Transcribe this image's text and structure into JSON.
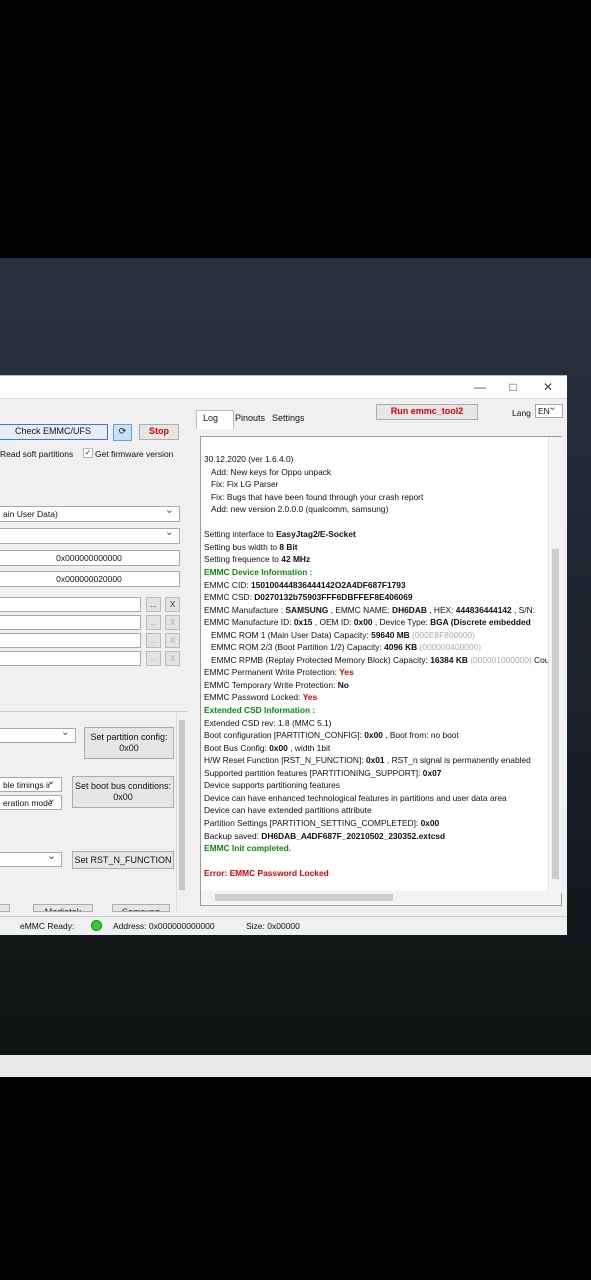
{
  "window": {
    "minimize": "—",
    "maximize": "□",
    "close": "✕"
  },
  "left": {
    "check_btn": "Check EMMC/UFS",
    "stop_btn": "Stop",
    "read_soft_partitions": "Read soft partitions",
    "get_firmware_version": "Get firmware version",
    "partition_select": "ain User Data)",
    "addr1": "0x000000000000",
    "addr2": "0x000000020000",
    "browse": "...",
    "clear": "X",
    "set_partition_config": "Set partition config:",
    "partition_config_value": "0x00",
    "timings_select": "ble timings ir",
    "operation_mode_select": "eration mode",
    "set_boot_bus": "Set boot bus conditions:",
    "boot_bus_value": "0x00",
    "set_rst": "Set RST_N_FUNCTION",
    "bottom_btn1": "Mediatek",
    "bottom_btn2": "Samsung"
  },
  "right": {
    "tabs": [
      "Log",
      "Pinouts",
      "Settings"
    ],
    "run_btn": "Run emmc_tool2",
    "lang_label": "Lang",
    "lang_value": "EN"
  },
  "log": [
    {
      "t": "30.12.2020 (ver 1.6.4.0)"
    },
    {
      "t": "  Add:   New keys for Oppo unpack",
      "i": true
    },
    {
      "t": "  Fix:    Fix LG Parser",
      "i": true
    },
    {
      "t": "  Fix:    Bugs that have been found through your crash report",
      "i": true
    },
    {
      "t": "  Add:   new version 2.0.0.0 (qualcomm, samsung)",
      "i": true
    },
    {
      "t": ""
    },
    {
      "t": "Setting interface to ",
      "b": "EasyJtag2/E-Socket"
    },
    {
      "t": "Setting bus width to ",
      "b": "8 Bit"
    },
    {
      "t": "Setting frequence to ",
      "b": "42 MHz"
    },
    {
      "t": "EMMC Device Information :",
      "c": "g"
    },
    {
      "t": "EMMC CID: ",
      "b": "150100444836444142O2A4DF687F1793"
    },
    {
      "t": "EMMC CSD: ",
      "b": "D0270132b75903FFF6DBFFEF8E406069"
    },
    {
      "t": "EMMC Manufacture : ",
      "b": "SAMSUNG",
      "t2": " , EMMC NAME: ",
      "b2": "DH6DAB",
      "t3": " , HEX: ",
      "b3": "444836444142",
      "t4": " , S/N:"
    },
    {
      "t": "EMMC Manufacture ID: ",
      "b": "0x15",
      "t2": " , OEM ID: ",
      "b2": "0x00",
      "t3": " , Device Type: ",
      "b3": "BGA (Discrete embedded"
    },
    {
      "t": "  EMMC ROM 1 (Main User Data) Capacity: ",
      "b": "59640 MB",
      "gr": " (000E8F800000)",
      "i": true
    },
    {
      "t": "  EMMC ROM 2/3 (Boot Partition 1/2) Capacity: ",
      "b": "4096 KB",
      "gr": " (000000400000)",
      "i": true
    },
    {
      "t": "  EMMC RPMB (Replay Protected Memory Block) Capacity: ",
      "b": "16384 KB",
      "gr": " (000001000000)",
      "t4": "  Cou",
      "i": true
    },
    {
      "t": "EMMC Permanent Write Protection: ",
      "rv": "Yes"
    },
    {
      "t": "EMMC Temporary Write Protection: ",
      "b": "No"
    },
    {
      "t": "EMMC Password Locked: ",
      "rv": "Yes"
    },
    {
      "t": "Extended CSD Information :",
      "c": "g"
    },
    {
      "t": "Extended CSD rev: 1.8 (MMC 5.1)"
    },
    {
      "t": "Boot configuration [PARTITION_CONFIG]: ",
      "b": "0x00",
      "t2": " , Boot from: no boot"
    },
    {
      "t": "Boot Bus Config: ",
      "b": "0x00",
      "t2": " , width 1bit"
    },
    {
      "t": "H/W Reset Function [RST_N_FUNCTION]: ",
      "b": "0x01",
      "t2": " , RST_n signal is permanently enabled"
    },
    {
      "t": "Supported partition features [PARTITIONING_SUPPORT]: ",
      "b": "0x07"
    },
    {
      "t": "Device supports partitioning features"
    },
    {
      "t": "Device can have enhanced technological features in partitions and user data area"
    },
    {
      "t": "Device can have extended partitions attribute"
    },
    {
      "t": "Partition Settings [PARTITION_SETTING_COMPLETED]: ",
      "b": "0x00"
    },
    {
      "t": "Backup saved: ",
      "b": "DH6DAB_A4DF687F_20210502_230352.extcsd"
    },
    {
      "t": "EMMC Init completed.",
      "c": "g"
    },
    {
      "t": ""
    },
    {
      "t": "Error: EMMC Password Locked",
      "c": "r"
    }
  ],
  "status": {
    "ready": "eMMC Ready:",
    "address": "Address: 0x000000000000",
    "size": "Size: 0x00000"
  }
}
